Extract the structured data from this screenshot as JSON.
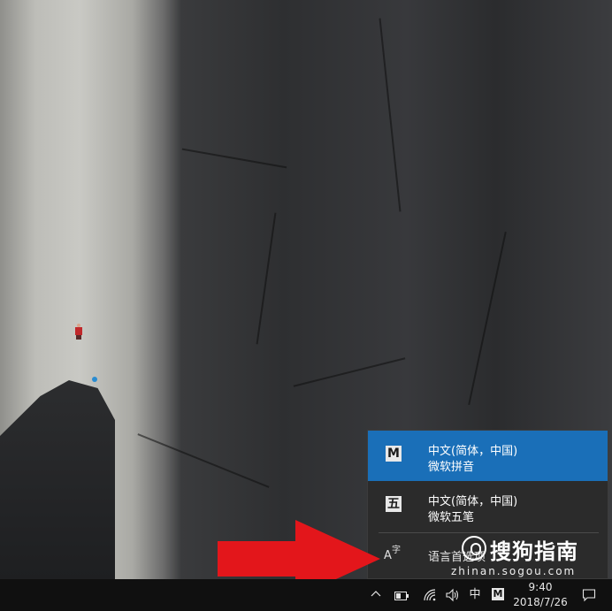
{
  "ime_flyout": {
    "items": [
      {
        "icon": "M",
        "icon_name": "microsoft-pinyin-icon",
        "line1": "中文(简体，中国)",
        "line2": "微软拼音",
        "selected": true
      },
      {
        "icon": "五",
        "icon_name": "microsoft-wubi-icon",
        "line1": "中文(简体，中国)",
        "line2": "微软五笔",
        "selected": false
      }
    ],
    "language_preferences": {
      "icon_name": "language-settings-icon",
      "icon_a": "A",
      "icon_zi": "字",
      "label": "语言首选项"
    }
  },
  "taskbar": {
    "show_hidden_icons": "chevron-up-icon",
    "battery_level": 0.45,
    "language_indicator": "中",
    "ime_indicator": "M",
    "time": "9:40",
    "date": "2018/7/26"
  },
  "watermark": {
    "title": "搜狗指南",
    "url": "zhinan.sogou.com"
  },
  "colors": {
    "accent": "#1a6fb8",
    "flyout_bg": "#2b2b2b",
    "taskbar_bg": "#101010",
    "arrow": "#e3161b"
  }
}
